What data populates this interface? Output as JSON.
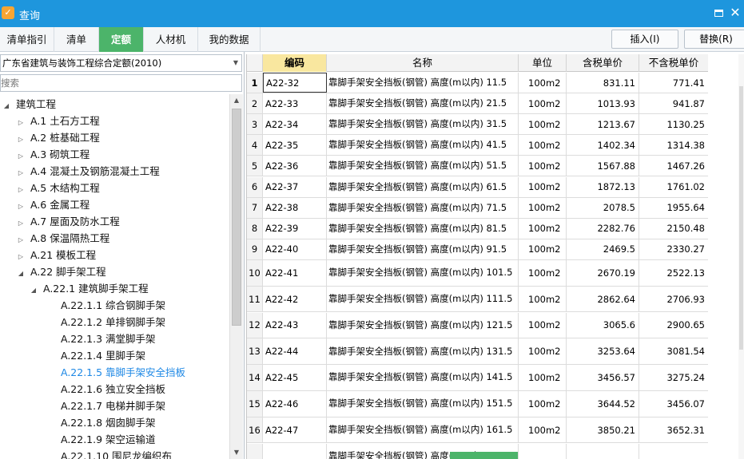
{
  "window": {
    "title": "查询",
    "app_icon_glyph": "✓"
  },
  "tabs": [
    {
      "label": "清单指引",
      "active": false
    },
    {
      "label": "清单",
      "active": false
    },
    {
      "label": "定额",
      "active": true
    },
    {
      "label": "人材机",
      "active": false
    },
    {
      "label": "我的数据",
      "active": false
    }
  ],
  "toolbar": {
    "insert_label": "插入(I)",
    "replace_label": "替换(R)"
  },
  "left": {
    "quota_library": "广东省建筑与装饰工程综合定额(2010)",
    "search_placeholder": "搜索"
  },
  "tree": [
    {
      "label": "建筑工程",
      "expanded": true
    },
    {
      "label": "A.1 土石方工程",
      "expanded": false
    },
    {
      "label": "A.2 桩基础工程",
      "expanded": false
    },
    {
      "label": "A.3 砌筑工程",
      "expanded": false
    },
    {
      "label": "A.4 混凝土及钢筋混凝土工程",
      "expanded": false
    },
    {
      "label": "A.5 木结构工程",
      "expanded": false
    },
    {
      "label": "A.6 金属工程",
      "expanded": false
    },
    {
      "label": "A.7 屋面及防水工程",
      "expanded": false
    },
    {
      "label": "A.8 保温隔热工程",
      "expanded": false
    },
    {
      "label": "A.21 模板工程",
      "expanded": false
    },
    {
      "label": "A.22 脚手架工程",
      "expanded": true
    },
    {
      "label": "A.22.1 建筑脚手架工程",
      "expanded": true
    },
    {
      "label": "A.22.1.1 综合钢脚手架"
    },
    {
      "label": "A.22.1.2 单排钢脚手架"
    },
    {
      "label": "A.22.1.3 满堂脚手架"
    },
    {
      "label": "A.22.1.4 里脚手架"
    },
    {
      "label": "A.22.1.5 靠脚手架安全挡板",
      "selected": true
    },
    {
      "label": "A.22.1.6 独立安全挡板"
    },
    {
      "label": "A.22.1.7 电梯井脚手架"
    },
    {
      "label": "A.22.1.8 烟囱脚手架"
    },
    {
      "label": "A.22.1.9 架空运输道"
    },
    {
      "label": "A.22.1.10 围尼龙编织布"
    }
  ],
  "grid": {
    "headers": {
      "code": "编码",
      "name": "名称",
      "unit": "单位",
      "price_tax": "含税单价",
      "price_notax": "不含税单价"
    },
    "rows": [
      {
        "no": "1",
        "code": "A22-32",
        "name": "靠脚手架安全挡板(钢管) 高度(m以内) 11.5",
        "unit": "100m2",
        "price_tax": "831.11",
        "price_notax": "771.41"
      },
      {
        "no": "2",
        "code": "A22-33",
        "name": "靠脚手架安全挡板(钢管) 高度(m以内) 21.5",
        "unit": "100m2",
        "price_tax": "1013.93",
        "price_notax": "941.87"
      },
      {
        "no": "3",
        "code": "A22-34",
        "name": "靠脚手架安全挡板(钢管) 高度(m以内) 31.5",
        "unit": "100m2",
        "price_tax": "1213.67",
        "price_notax": "1130.25"
      },
      {
        "no": "4",
        "code": "A22-35",
        "name": "靠脚手架安全挡板(钢管) 高度(m以内) 41.5",
        "unit": "100m2",
        "price_tax": "1402.34",
        "price_notax": "1314.38"
      },
      {
        "no": "5",
        "code": "A22-36",
        "name": "靠脚手架安全挡板(钢管) 高度(m以内) 51.5",
        "unit": "100m2",
        "price_tax": "1567.88",
        "price_notax": "1467.26"
      },
      {
        "no": "6",
        "code": "A22-37",
        "name": "靠脚手架安全挡板(钢管) 高度(m以内) 61.5",
        "unit": "100m2",
        "price_tax": "1872.13",
        "price_notax": "1761.02"
      },
      {
        "no": "7",
        "code": "A22-38",
        "name": "靠脚手架安全挡板(钢管) 高度(m以内) 71.5",
        "unit": "100m2",
        "price_tax": "2078.5",
        "price_notax": "1955.64"
      },
      {
        "no": "8",
        "code": "A22-39",
        "name": "靠脚手架安全挡板(钢管) 高度(m以内) 81.5",
        "unit": "100m2",
        "price_tax": "2282.76",
        "price_notax": "2150.48"
      },
      {
        "no": "9",
        "code": "A22-40",
        "name": "靠脚手架安全挡板(钢管) 高度(m以内) 91.5",
        "unit": "100m2",
        "price_tax": "2469.5",
        "price_notax": "2330.27"
      },
      {
        "no": "10",
        "code": "A22-41",
        "name": "靠脚手架安全挡板(钢管) 高度(m以内) 101.5",
        "unit": "100m2",
        "price_tax": "2670.19",
        "price_notax": "2522.13"
      },
      {
        "no": "11",
        "code": "A22-42",
        "name": "靠脚手架安全挡板(钢管) 高度(m以内) 111.5",
        "unit": "100m2",
        "price_tax": "2862.64",
        "price_notax": "2706.93"
      },
      {
        "no": "12",
        "code": "A22-43",
        "name": "靠脚手架安全挡板(钢管) 高度(m以内) 121.5",
        "unit": "100m2",
        "price_tax": "3065.6",
        "price_notax": "2900.65"
      },
      {
        "no": "13",
        "code": "A22-44",
        "name": "靠脚手架安全挡板(钢管) 高度(m以内) 131.5",
        "unit": "100m2",
        "price_tax": "3253.64",
        "price_notax": "3081.54"
      },
      {
        "no": "14",
        "code": "A22-45",
        "name": "靠脚手架安全挡板(钢管) 高度(m以内) 141.5",
        "unit": "100m2",
        "price_tax": "3456.57",
        "price_notax": "3275.24"
      },
      {
        "no": "15",
        "code": "A22-46",
        "name": "靠脚手架安全挡板(钢管) 高度(m以内) 151.5",
        "unit": "100m2",
        "price_tax": "3644.52",
        "price_notax": "3456.07"
      },
      {
        "no": "16",
        "code": "A22-47",
        "name": "靠脚手架安全挡板(钢管) 高度(m以内) 161.5",
        "unit": "100m2",
        "price_tax": "3850.21",
        "price_notax": "3652.31"
      },
      {
        "no": "",
        "code": "",
        "name": "靠脚手架安全挡板(钢管) 高度(m以内)",
        "unit": "",
        "price_tax": "",
        "price_notax": ""
      }
    ]
  },
  "colors": {
    "titlebar": "#1E96DD",
    "active_tab": "#4CB46A",
    "code_header": "#F9E79F",
    "selected_tree": "#1E88E5"
  }
}
